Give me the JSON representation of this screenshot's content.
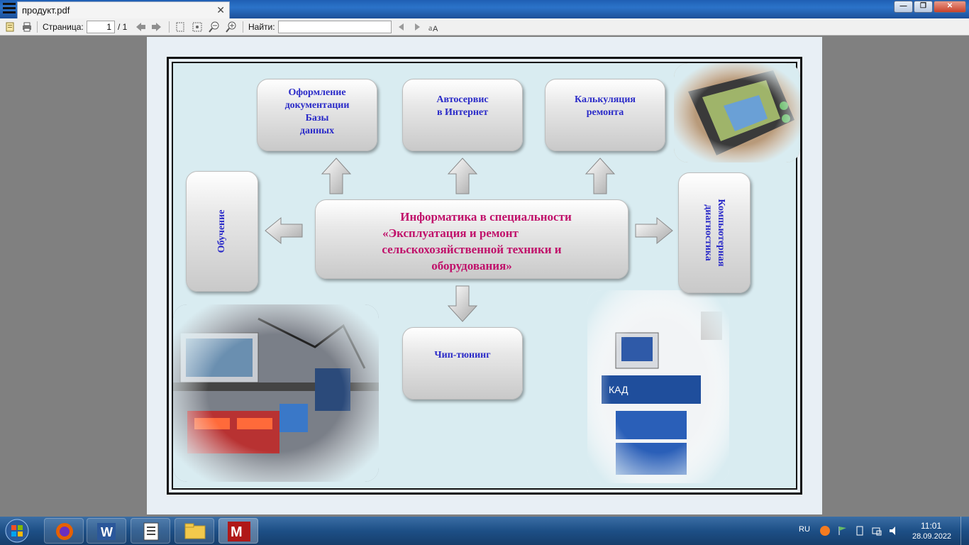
{
  "window": {
    "tab_title": "продукт.pdf",
    "tab_close": "✕",
    "min": "—",
    "max": "❐",
    "close": "✕"
  },
  "toolbar": {
    "page_label": "Страница:",
    "page_value": "1",
    "page_total": "/ 1",
    "find_label": "Найти:",
    "find_value": ""
  },
  "diagram": {
    "center_lines": [
      "Информатика в  специальности",
      "«Эксплуатация и ремонт",
      "сельскохозяйственной техники и",
      "оборудования»"
    ],
    "top_left_lines": [
      "Оформление",
      "документации",
      "Базы",
      "данных"
    ],
    "top_middle_lines": [
      "Автосервис",
      "в Интернет"
    ],
    "top_right_lines": [
      "Калькуляция",
      "ремонта"
    ],
    "left": "Обучение",
    "right_lines": [
      "Компьютерная",
      "диагностика"
    ],
    "bottom": "Чип-тюнинг"
  },
  "colors": {
    "center_text": "#c0106a",
    "box_text": "#2a2ac8",
    "page_bg": "#d9ecf1"
  },
  "taskbar": {
    "lang": "RU",
    "time": "11:01",
    "date": "28.09.2022"
  }
}
